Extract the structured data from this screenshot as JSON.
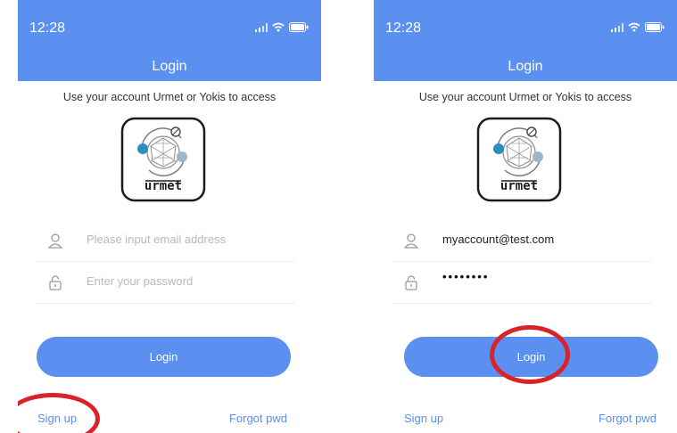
{
  "screens": [
    {
      "status": {
        "time": "12:28"
      },
      "header": {
        "title": "Login"
      },
      "subtitle": "Use your account Urmet or Yokis to access",
      "logo": {
        "text": "urmet"
      },
      "email": {
        "placeholder": "Please input email address",
        "value": ""
      },
      "password": {
        "placeholder": "Enter your password",
        "value": ""
      },
      "login_label": "Login",
      "signup_label": "Sign up",
      "forgot_label": "Forgot pwd"
    },
    {
      "status": {
        "time": "12:28"
      },
      "header": {
        "title": "Login"
      },
      "subtitle": "Use your account Urmet or Yokis to access",
      "logo": {
        "text": "urmet"
      },
      "email": {
        "placeholder": "",
        "value": "myaccount@test.com"
      },
      "password": {
        "placeholder": "",
        "value": "••••••••"
      },
      "login_label": "Login",
      "signup_label": "Sign up",
      "forgot_label": "Forgot pwd"
    }
  ],
  "colors": {
    "accent": "#5b8ff0",
    "annotation": "#d8232a"
  }
}
